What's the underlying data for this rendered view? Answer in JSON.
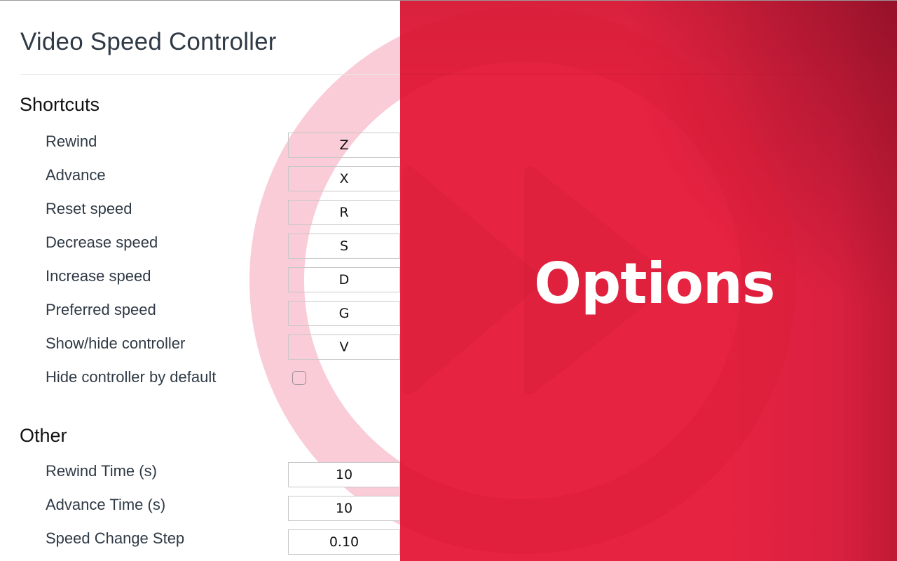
{
  "page": {
    "title": "Video Speed Controller",
    "banner_text": "Options"
  },
  "colors": {
    "brand_red": "#e8223f",
    "ring_pink": "#f9ccd7",
    "text_dark": "#2f3a46"
  },
  "shortcuts": {
    "heading": "Shortcuts",
    "items": [
      {
        "label": "Rewind",
        "key": "Z"
      },
      {
        "label": "Advance",
        "key": "X"
      },
      {
        "label": "Reset speed",
        "key": "R"
      },
      {
        "label": "Decrease speed",
        "key": "S"
      },
      {
        "label": "Increase speed",
        "key": "D"
      },
      {
        "label": "Preferred speed",
        "key": "G"
      },
      {
        "label": "Show/hide controller",
        "key": "V"
      }
    ],
    "hide_by_default": {
      "label": "Hide controller by default",
      "checked": false
    }
  },
  "other": {
    "heading": "Other",
    "items": [
      {
        "label": "Rewind Time (s)",
        "value": "10"
      },
      {
        "label": "Advance Time (s)",
        "value": "10"
      },
      {
        "label": "Speed Change Step",
        "value": "0.10"
      }
    ]
  },
  "icons": {
    "background_logo": "play-ring-logo-icon"
  }
}
